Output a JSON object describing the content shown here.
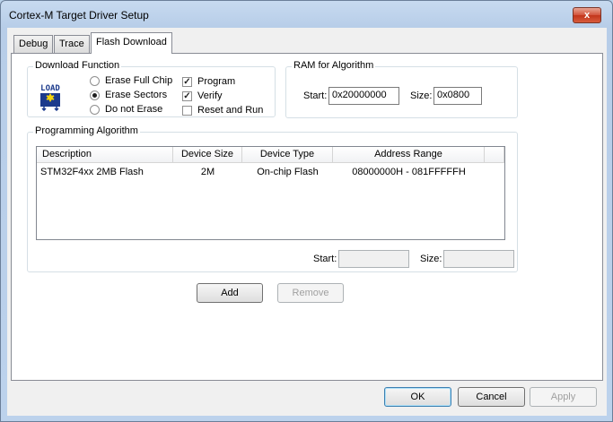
{
  "window": {
    "title": "Cortex-M Target Driver Setup",
    "close_glyph": "x"
  },
  "tabs": [
    {
      "label": "Debug"
    },
    {
      "label": "Trace"
    },
    {
      "label": "Flash Download",
      "active": true
    }
  ],
  "download_function": {
    "title": "Download Function",
    "icon_text": "LOAD",
    "radios": [
      {
        "label": "Erase Full Chip",
        "selected": false
      },
      {
        "label": "Erase Sectors",
        "selected": true
      },
      {
        "label": "Do not Erase",
        "selected": false
      }
    ],
    "checks": [
      {
        "label": "Program",
        "checked": true
      },
      {
        "label": "Verify",
        "checked": true
      },
      {
        "label": "Reset and Run",
        "checked": false
      }
    ]
  },
  "ram": {
    "title": "RAM for Algorithm",
    "start_label": "Start:",
    "start_value": "0x20000000",
    "size_label": "Size:",
    "size_value": "0x0800"
  },
  "algorithm": {
    "title": "Programming Algorithm",
    "columns": [
      "Description",
      "Device Size",
      "Device Type",
      "Address Range"
    ],
    "rows": [
      {
        "description": "STM32F4xx 2MB Flash",
        "size": "2M",
        "type": "On-chip Flash",
        "range": "08000000H - 081FFFFFH"
      }
    ],
    "start_label": "Start:",
    "start_value": "",
    "size_label": "Size:",
    "size_value": ""
  },
  "buttons": {
    "add": "Add",
    "remove": "Remove",
    "ok": "OK",
    "cancel": "Cancel",
    "apply": "Apply"
  },
  "colors": {
    "accent": "#3c7fb1",
    "icon_blue": "#1b3a8c",
    "icon_yellow": "#f5d50c"
  }
}
